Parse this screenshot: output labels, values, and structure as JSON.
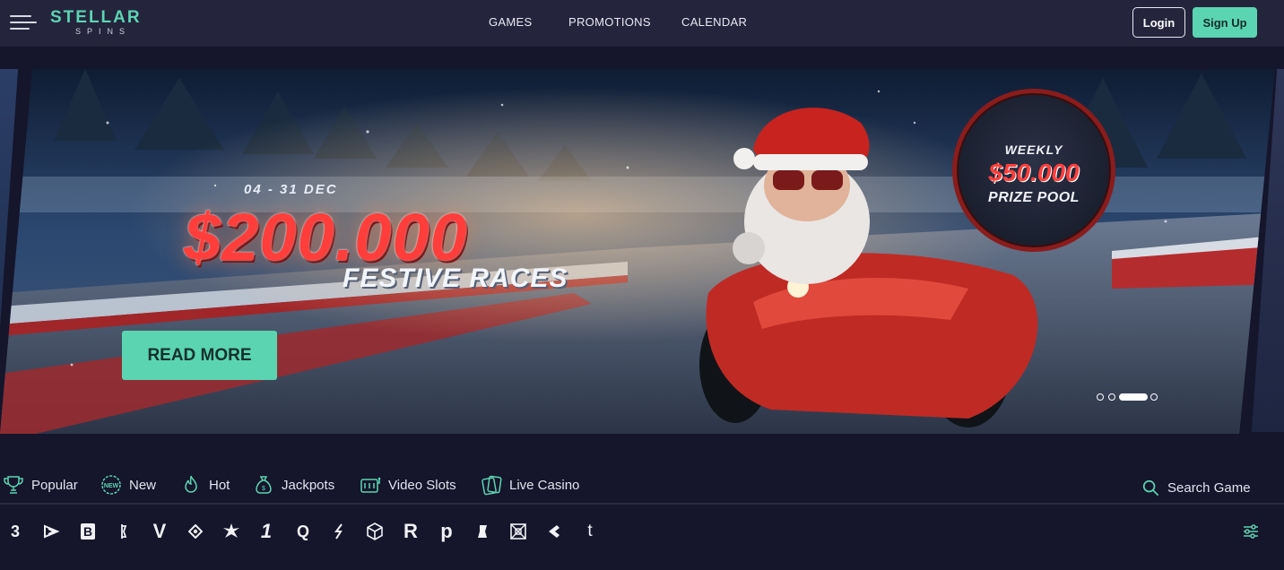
{
  "header": {
    "logo_top": "STELLAR",
    "logo_bottom": "SPINS",
    "nav": [
      "GAMES",
      "PROMOTIONS",
      "CALENDAR"
    ],
    "login_label": "Login",
    "signup_label": "Sign Up",
    "brand_color": "#5bd5b1"
  },
  "banner": {
    "date": "04 - 31 DEC",
    "amount": "$200.000",
    "subtitle": "FESTIVE RACES",
    "badge": {
      "line1": "WEEKLY",
      "line2": "$50.000",
      "line3": "PRIZE POOL"
    },
    "cta_label": "READ MORE",
    "slides_count": 4,
    "active_slide": 3
  },
  "categories": [
    {
      "label": "Popular",
      "icon": "trophy-icon"
    },
    {
      "label": "New",
      "icon": "new-badge-icon"
    },
    {
      "label": "Hot",
      "icon": "flame-icon"
    },
    {
      "label": "Jackpots",
      "icon": "money-bag-icon"
    },
    {
      "label": "Video Slots",
      "icon": "slot-machine-icon"
    },
    {
      "label": "Live Casino",
      "icon": "cards-icon"
    }
  ],
  "search": {
    "label": "Search Game",
    "icon": "search-icon"
  },
  "providers": [
    "3",
    "B",
    "V",
    "1",
    "Q",
    "R",
    "p",
    "t"
  ]
}
